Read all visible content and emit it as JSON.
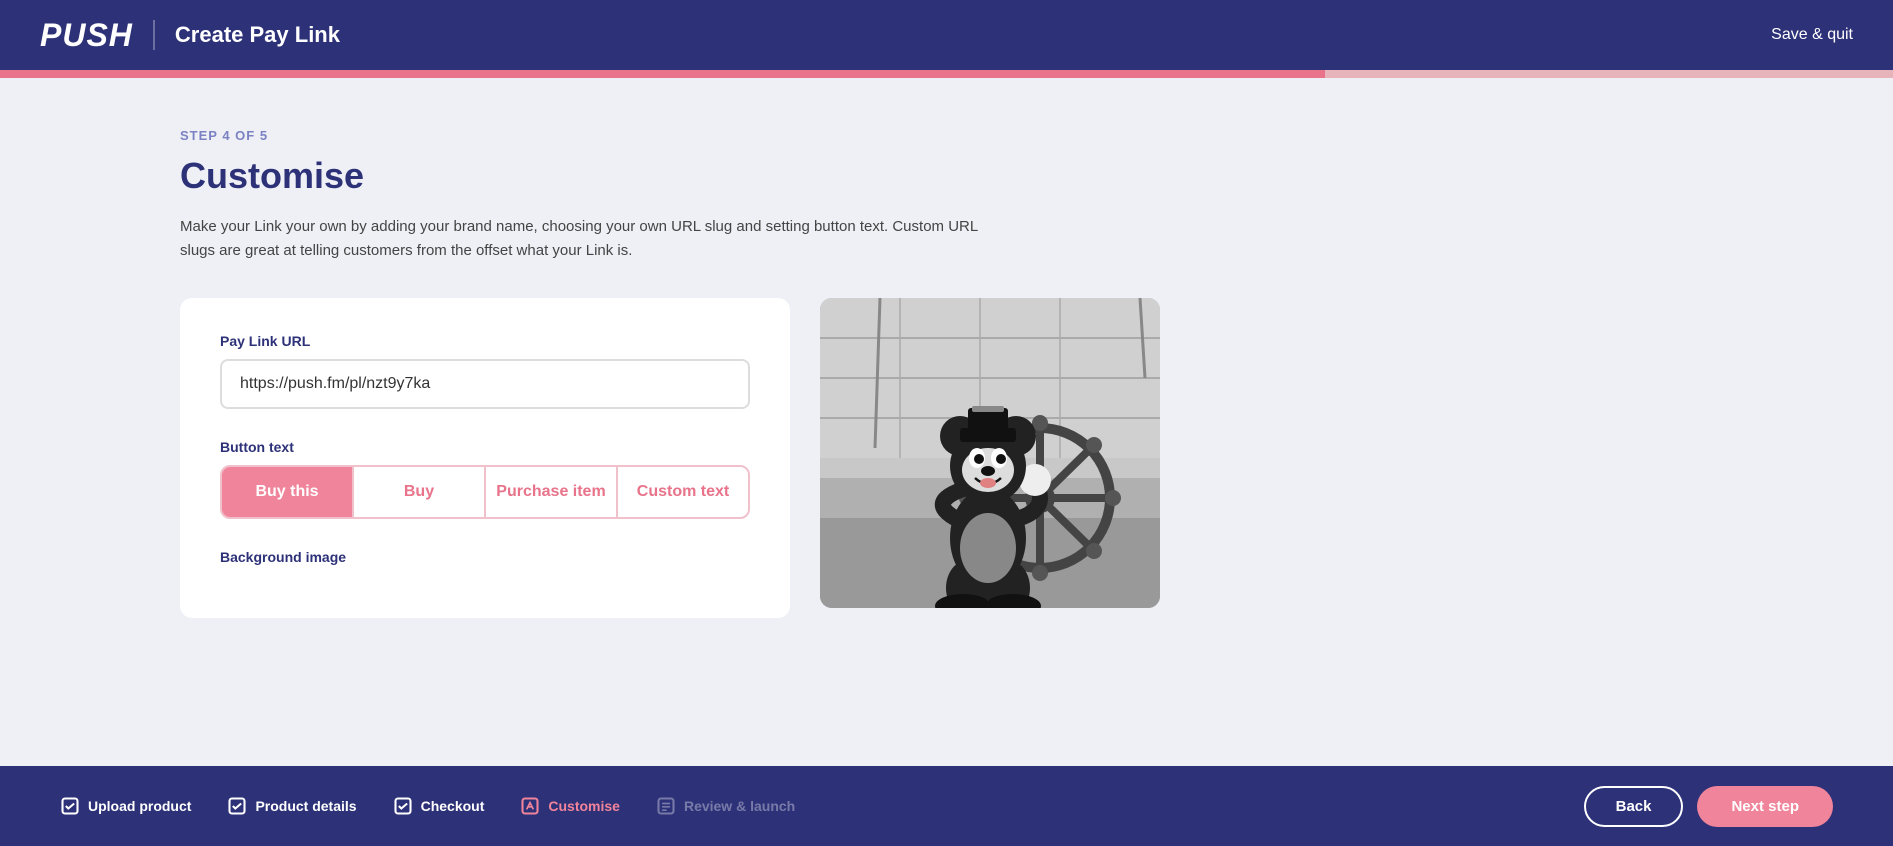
{
  "header": {
    "logo": "PUSH",
    "title": "Create Pay Link",
    "save_quit_label": "Save & quit"
  },
  "progress": {
    "fill_percent": 70
  },
  "page": {
    "step_label": "STEP 4 OF 5",
    "heading": "Customise",
    "description": "Make your Link your own by adding your brand name, choosing your own URL slug and setting button text. Custom URL slugs are great at telling customers from the offset what your Link is."
  },
  "card": {
    "url_label": "Pay Link URL",
    "url_value": "https://push.fm/pl/nzt9y7ka",
    "button_text_label": "Button text",
    "button_options": [
      {
        "label": "Buy this",
        "active": true
      },
      {
        "label": "Buy",
        "active": false
      },
      {
        "label": "Purchase item",
        "active": false
      },
      {
        "label": "Custom text",
        "active": false
      }
    ],
    "bg_image_label": "Background image"
  },
  "bottom_nav": {
    "steps": [
      {
        "label": "Upload product",
        "state": "completed"
      },
      {
        "label": "Product details",
        "state": "completed"
      },
      {
        "label": "Checkout",
        "state": "completed"
      },
      {
        "label": "Customise",
        "state": "active"
      },
      {
        "label": "Review & launch",
        "state": "inactive"
      }
    ],
    "back_label": "Back",
    "next_label": "Next step"
  }
}
